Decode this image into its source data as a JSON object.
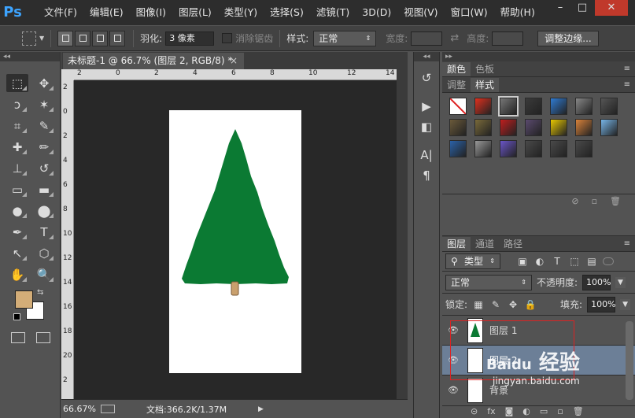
{
  "app": {
    "logo": "Ps"
  },
  "menu": [
    "文件(F)",
    "编辑(E)",
    "图像(I)",
    "图层(L)",
    "类型(Y)",
    "选择(S)",
    "滤镜(T)",
    "3D(D)",
    "视图(V)",
    "窗口(W)",
    "帮助(H)"
  ],
  "window_controls": {
    "minimize": "–",
    "maximize": "□",
    "close": "✕"
  },
  "options": {
    "feather_label": "羽化:",
    "feather_value": "3 像素",
    "antialias_label": "消除锯齿",
    "style_label": "样式:",
    "style_value": "正常",
    "width_label": "宽度:",
    "height_label": "高度:",
    "refine_button": "调整边缘..."
  },
  "document": {
    "tab_title": "未标题-1 @ 66.7% (图层 2, RGB/8) *",
    "tab_close": "×",
    "ruler_h": [
      "2",
      "0",
      "2",
      "4",
      "6",
      "8",
      "10",
      "12",
      "14"
    ],
    "ruler_v": [
      "2",
      "0",
      "2",
      "4",
      "6",
      "8",
      "10",
      "12",
      "14",
      "16",
      "18",
      "20",
      "2"
    ],
    "zoom": "66.67%",
    "doc_info": "文档:366.2K/1.37M",
    "colors": {
      "tree": "#0b7a33",
      "trunk": "#c9a06d",
      "canvas": "#ffffff",
      "pasteboard": "#282828"
    }
  },
  "tools": [
    "rect-marquee",
    "move",
    "lasso",
    "magic-wand",
    "crop",
    "eyedropper",
    "healing-brush",
    "brush",
    "clone-stamp",
    "history-brush",
    "eraser",
    "gradient",
    "blur",
    "dodge",
    "pen",
    "type",
    "path-select",
    "shape",
    "hand",
    "zoom"
  ],
  "tool_glyphs": [
    "⬚",
    "✥",
    "ↄ",
    "✶",
    "⌗",
    "✎",
    "✚",
    "✏",
    "⊥",
    "↺",
    "▭",
    "▬",
    "●",
    "⬤",
    "✒",
    "T",
    "↖",
    "⬡",
    "✋",
    "🔍"
  ],
  "colors_fg_bg": {
    "foreground": "#d3ad78",
    "background": "#ffffff"
  },
  "minidock": {
    "icons": [
      "history-icon",
      "actions-icon",
      "layer-comps-icon",
      "character-icon",
      "paragraph-icon"
    ],
    "glyphs": [
      "↺",
      "▶",
      "◧",
      "A|",
      "¶"
    ]
  },
  "color_panel": {
    "tabs": [
      "颜色",
      "色板"
    ],
    "active": 0
  },
  "styles_panel": {
    "tabs": [
      "调整",
      "样式"
    ],
    "active": 1,
    "swatches": [
      "none",
      "#e0301e",
      "#777777",
      "#3a3a3a",
      "#2f7bd3",
      "#888888",
      "#555555",
      "#6b5a3a",
      "#7a6a3a",
      "#c01e1e",
      "#5a4a6e",
      "#e8c800",
      "#d9823a",
      "#77b5e8",
      "#2b62a8",
      "#999999",
      "#6a55c8",
      "#4a4a4a",
      "#4a4a4a",
      "#4a4a4a"
    ]
  },
  "layers_panel": {
    "tabs": [
      "图层",
      "通道",
      "路径"
    ],
    "active": 0,
    "filter_kind": "类型",
    "blend_mode": "正常",
    "opacity_label": "不透明度:",
    "opacity_value": "100%",
    "lock_label": "锁定:",
    "fill_label": "填充:",
    "fill_value": "100%",
    "layers": [
      {
        "name": "图层 1",
        "selected": false
      },
      {
        "name": "图层 2",
        "selected": true
      },
      {
        "name": "背景",
        "selected": false
      }
    ]
  },
  "watermark": {
    "brand": "Baidu",
    "text": "经验",
    "url": "jingyan.baidu.com"
  }
}
